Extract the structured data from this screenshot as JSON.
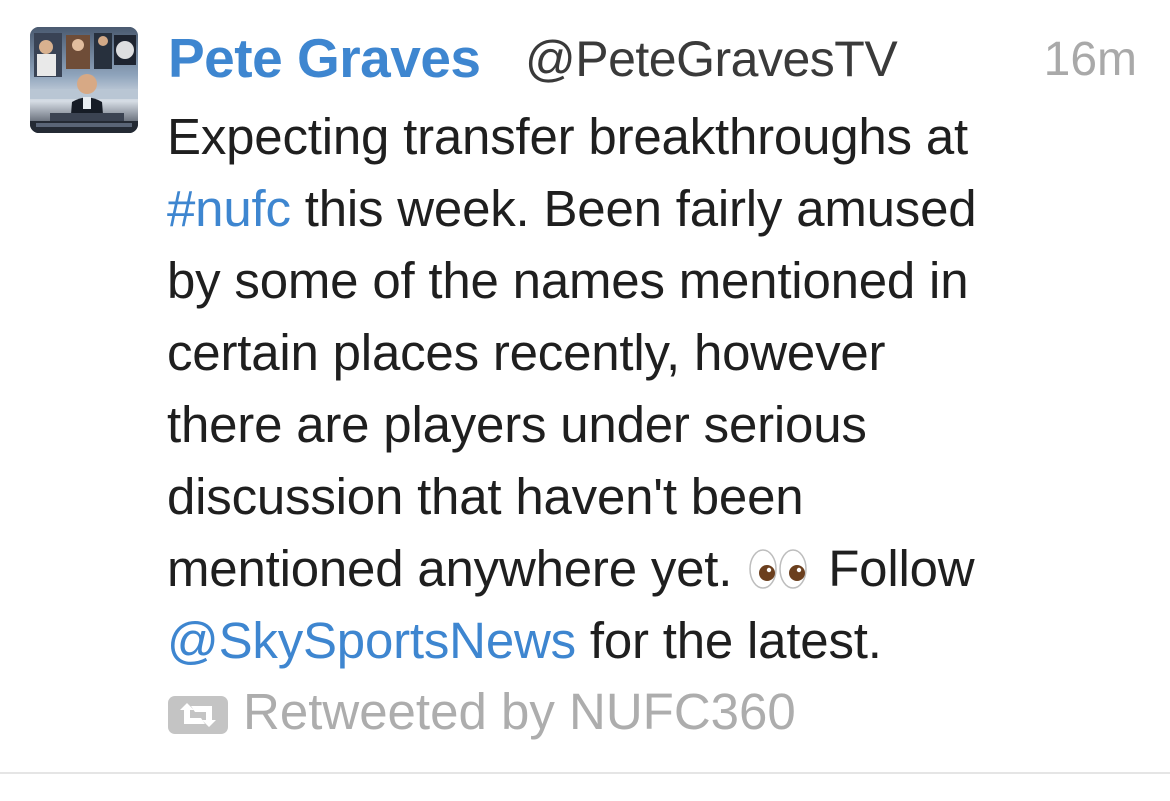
{
  "tweet": {
    "author_name": "Pete Graves",
    "author_handle": "@PeteGravesTV",
    "timestamp": "16m",
    "avatar_alt": "avatar",
    "lines": [
      {
        "segments": [
          {
            "text": "Expecting transfer breakthroughs at",
            "type": "text"
          }
        ]
      },
      {
        "segments": [
          {
            "text": "#nufc",
            "type": "hashtag"
          },
          {
            "text": " this week. Been fairly amused",
            "type": "text"
          }
        ]
      },
      {
        "segments": [
          {
            "text": "by some of the names mentioned in",
            "type": "text"
          }
        ]
      },
      {
        "segments": [
          {
            "text": "certain places recently, however",
            "type": "text"
          }
        ]
      },
      {
        "segments": [
          {
            "text": "there are players under serious",
            "type": "text"
          }
        ]
      },
      {
        "segments": [
          {
            "text": "discussion that haven't been",
            "type": "text"
          }
        ]
      },
      {
        "segments": [
          {
            "text": "mentioned anywhere yet.",
            "type": "text"
          },
          {
            "type": "emoji",
            "name": "eyes-emoji"
          },
          {
            "text": "Follow",
            "type": "text"
          }
        ]
      },
      {
        "segments": [
          {
            "text": "@SkySportsNews",
            "type": "mention"
          },
          {
            "text": " for the latest.",
            "type": "text"
          }
        ]
      }
    ],
    "retweet": {
      "icon": "retweet-icon",
      "label": "Retweeted by NUFC360"
    }
  },
  "colors": {
    "link": "#3e86d0",
    "text": "#1f1f1f",
    "muted": "#adadad",
    "divider": "#e5e5e5"
  }
}
